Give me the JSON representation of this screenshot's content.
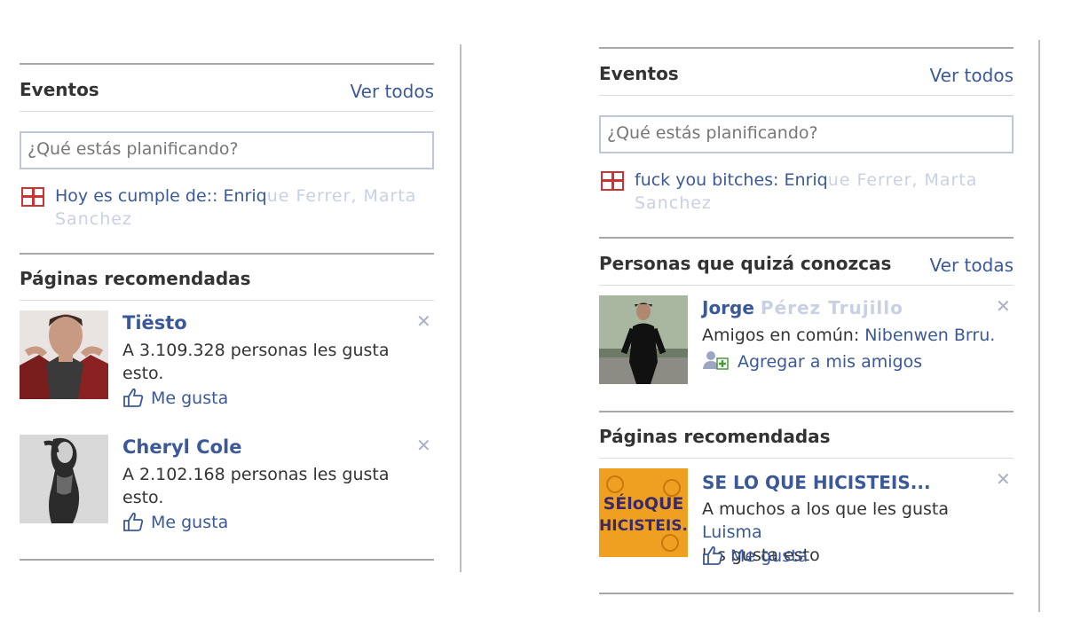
{
  "left_panel": {
    "events": {
      "title": "Eventos",
      "see_all": "Ver todos",
      "input_placeholder": "¿Qué estás planificando?",
      "birthday_prefix": "Hoy es cumple de:: Enriq",
      "birthday_blurred": "ue Ferrer, Marta",
      "birthday_line2": "Sanchez"
    },
    "pages": {
      "title": "Páginas recomendadas",
      "items": [
        {
          "name": "Tiësto",
          "desc": "A 3.109.328 personas les gusta esto.",
          "like": "Me gusta"
        },
        {
          "name": "Cheryl Cole",
          "desc": "A 2.102.168 personas les gusta esto.",
          "like": "Me gusta"
        }
      ]
    }
  },
  "right_panel": {
    "events": {
      "title": "Eventos",
      "see_all": "Ver todos",
      "input_placeholder": "¿Qué estás planificando?",
      "event_prefix": "fuck you bitches: Enriq",
      "event_blurred": "ue Ferrer, Marta",
      "event_line2": "Sanchez"
    },
    "people": {
      "title": "Personas que quizá conozcas",
      "see_all": "Ver todas",
      "person_name_visible": "Jorge",
      "person_name_blurred": "Pérez Trujillo",
      "mutual_label": "Amigos en común:",
      "mutual_friend": "Nibenwen Brru.",
      "add_friend": "Agregar a mis amigos"
    },
    "pages": {
      "title": "Páginas recomendadas",
      "item": {
        "name": "SE LO QUE HICISTEIS...",
        "desc_prefix": "A muchos a los que les gusta",
        "desc_link": "Luisma",
        "desc_suffix": "les gusta esto",
        "like": "Me gusta",
        "logo_text_line1": "SÉloQUE",
        "logo_text_line2": "HICISTEIS."
      }
    }
  },
  "colors": {
    "link": "#3b5998",
    "text": "#333333",
    "divider": "#a8a8a8",
    "gift": "#cc3333"
  },
  "icons": [
    "gift-icon",
    "thumbs-up-icon",
    "close-icon",
    "add-friend-icon"
  ]
}
